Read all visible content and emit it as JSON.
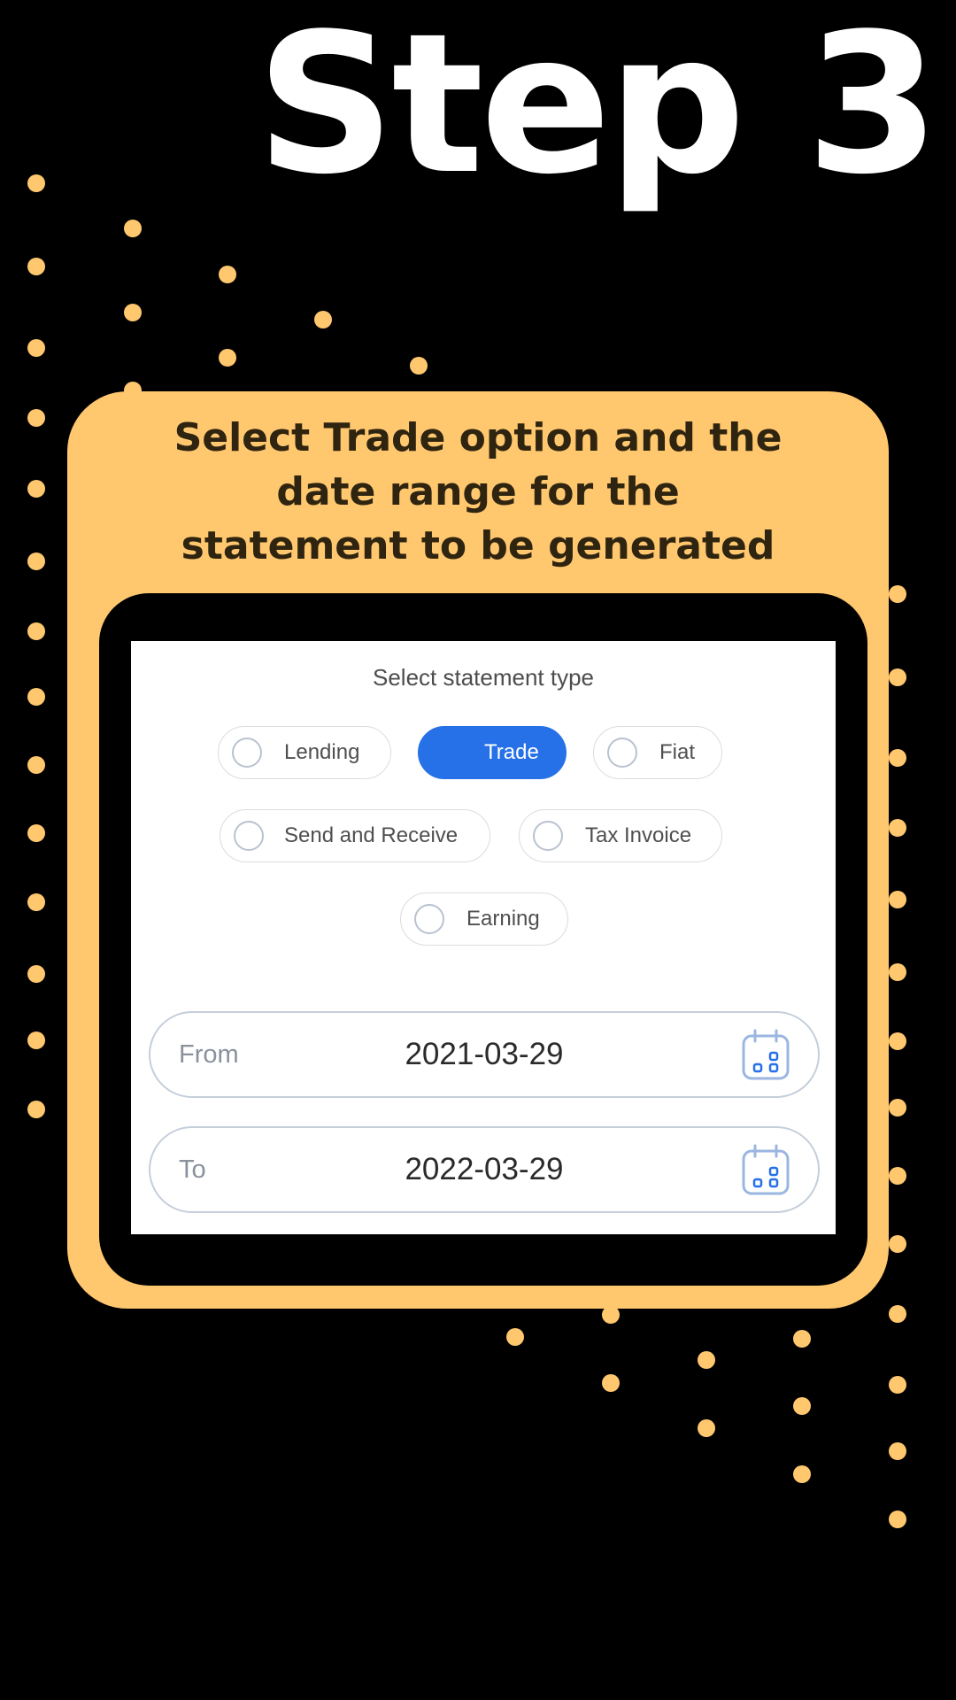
{
  "colors": {
    "background": "#000000",
    "accent": "#ffc76e",
    "primary": "#2670e8",
    "dot": "#ffc76e"
  },
  "step_title": "Step 3",
  "instruction": {
    "line1": "Select Trade option and the",
    "line2": "date range for the",
    "line3": "statement to be generated"
  },
  "statement_type": {
    "label": "Select statement type",
    "options": [
      {
        "label": "Lending",
        "selected": false
      },
      {
        "label": "Trade",
        "selected": true
      },
      {
        "label": "Fiat",
        "selected": false
      },
      {
        "label": "Send and Receive",
        "selected": false
      },
      {
        "label": "Tax Invoice",
        "selected": false
      },
      {
        "label": "Earning",
        "selected": false
      }
    ]
  },
  "date_range": {
    "from": {
      "label": "From",
      "value": "2021-03-29",
      "icon": "calendar-icon"
    },
    "to": {
      "label": "To",
      "value": "2022-03-29",
      "icon": "calendar-icon"
    }
  }
}
